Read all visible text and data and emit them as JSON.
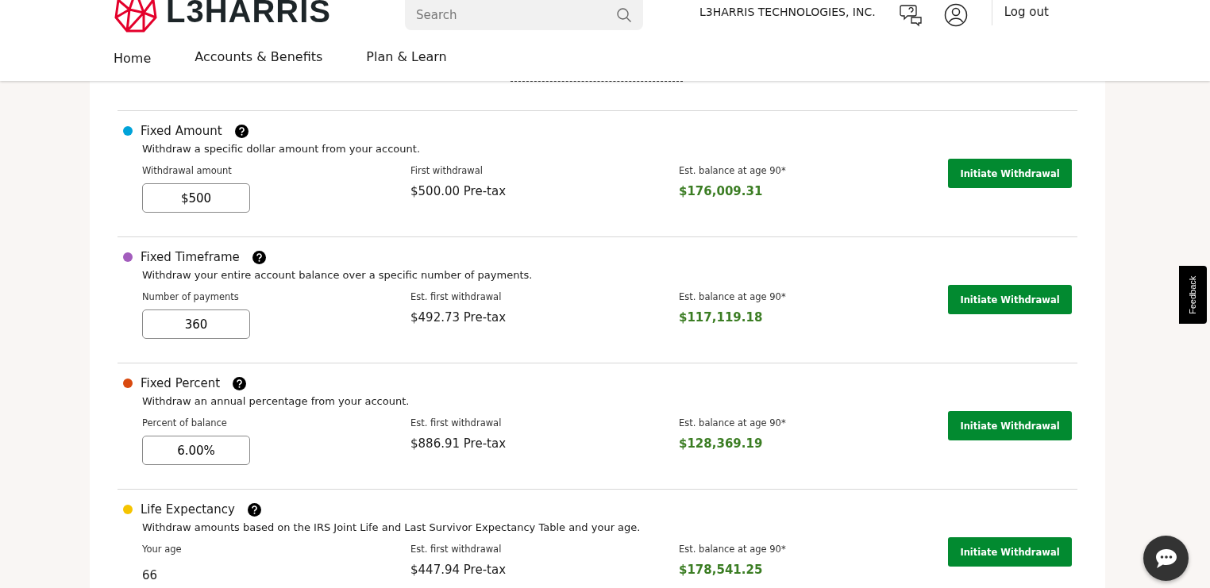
{
  "header": {
    "logo": "L3HARRIS",
    "search": {
      "placeholder": "Search"
    },
    "company": "L3HARRIS TECHNOLOGIES, INC.",
    "logout": "Log out"
  },
  "nav": [
    {
      "label": "Home"
    },
    {
      "label": "Accounts & Benefits"
    },
    {
      "label": "Plan & Learn"
    }
  ],
  "options": [
    {
      "title": "Fixed Amount",
      "color": "#00a3d9",
      "description": "Withdraw a specific dollar amount from your account.",
      "input_label": "Withdrawal amount",
      "kind": "field",
      "input_value": "$500",
      "first_label": "First withdrawal",
      "first_value": "$500.00 Pre-tax",
      "balance_label": "Est. balance at age 90*",
      "balance_value": "$176,009.31",
      "button": "Initiate Withdrawal"
    },
    {
      "title": "Fixed Timeframe",
      "color": "#a35dbd",
      "description": "Withdraw your entire account balance over a specific number of payments.",
      "input_label": "Number of payments",
      "kind": "field",
      "input_value": "360",
      "first_label": "Est. first withdrawal",
      "first_value": "$492.73 Pre-tax",
      "balance_label": "Est. balance at age 90*",
      "balance_value": "$117,119.18",
      "button": "Initiate Withdrawal"
    },
    {
      "title": "Fixed Percent",
      "color": "#d94a0f",
      "description": "Withdraw an annual percentage from your account.",
      "input_label": "Percent of balance",
      "kind": "field",
      "input_value": "6.00%",
      "first_label": "Est. first withdrawal",
      "first_value": "$886.91 Pre-tax",
      "balance_label": "Est. balance at age 90*",
      "balance_value": "$128,369.19",
      "button": "Initiate Withdrawal"
    },
    {
      "title": "Life Expectancy",
      "color": "#f5c400",
      "description": "Withdraw amounts based on the IRS Joint Life and Last Survivor Expectancy Table and your age.",
      "input_label": "Your age",
      "kind": "text",
      "input_value": "66",
      "first_label": "Est. first withdrawal",
      "first_value": "$447.94 Pre-tax",
      "balance_label": "Est. balance at age 90*",
      "balance_value": "$178,541.25",
      "button": "Initiate Withdrawal"
    }
  ],
  "feedback": "Feedback"
}
